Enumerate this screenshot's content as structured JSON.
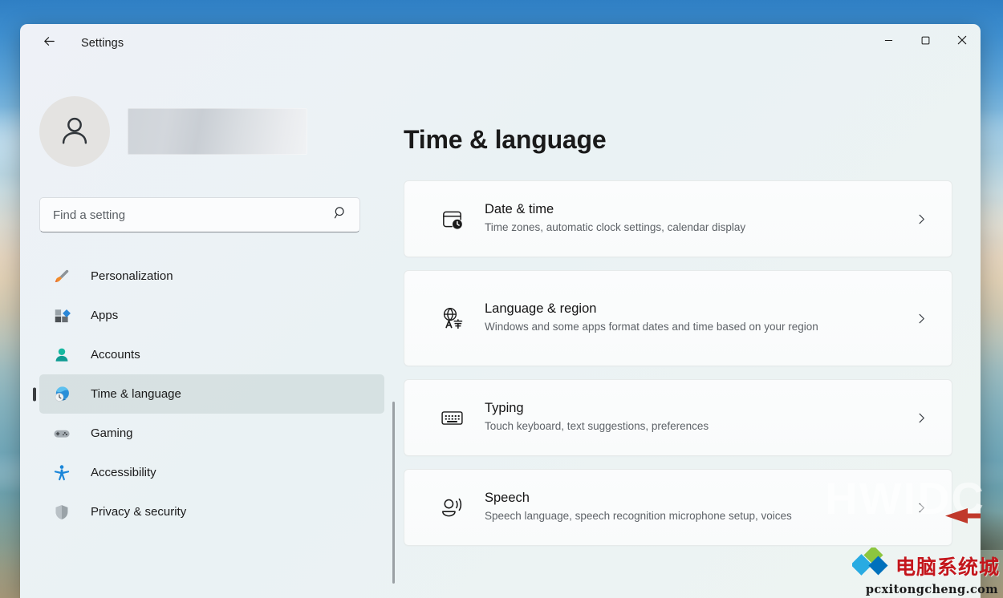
{
  "window": {
    "title": "Settings",
    "back_icon": "back-arrow-icon",
    "controls": {
      "minimize": "minimize-icon",
      "maximize": "maximize-icon",
      "close": "close-icon"
    }
  },
  "sidebar": {
    "avatar_icon": "user-avatar-icon",
    "account_name": "",
    "search": {
      "placeholder": "Find a setting",
      "value": "",
      "icon": "search-icon"
    },
    "items": [
      {
        "label": "Personalization",
        "icon": "paintbrush-icon",
        "active": false
      },
      {
        "label": "Apps",
        "icon": "apps-grid-icon",
        "active": false
      },
      {
        "label": "Accounts",
        "icon": "person-icon",
        "active": false
      },
      {
        "label": "Time & language",
        "icon": "globe-clock-icon",
        "active": true
      },
      {
        "label": "Gaming",
        "icon": "gamepad-icon",
        "active": false
      },
      {
        "label": "Accessibility",
        "icon": "accessibility-icon",
        "active": false
      },
      {
        "label": "Privacy & security",
        "icon": "shield-icon",
        "active": false
      }
    ]
  },
  "main": {
    "page_title": "Time & language",
    "cards": [
      {
        "title": "Date & time",
        "subtitle": "Time zones, automatic clock settings, calendar display",
        "icon": "calendar-clock-icon",
        "chevron": "chevron-right-icon"
      },
      {
        "title": "Language & region",
        "subtitle": "Windows and some apps format dates and time based on your region",
        "icon": "globe-language-icon",
        "chevron": "chevron-right-icon"
      },
      {
        "title": "Typing",
        "subtitle": "Touch keyboard, text suggestions, preferences",
        "icon": "keyboard-icon",
        "chevron": "chevron-right-icon"
      },
      {
        "title": "Speech",
        "subtitle": "Speech language, speech recognition microphone setup, voices",
        "icon": "speech-icon",
        "chevron": "chevron-right-icon"
      }
    ]
  },
  "annotation": {
    "arrow_color": "#c0392b",
    "points_to": "Speech"
  },
  "watermarks": {
    "faint_text": "HWIDC",
    "logo_text": "电脑系统城",
    "logo_url": "pcxitongcheng.com"
  },
  "colors": {
    "accent_selected": "#bccdcd",
    "window_bg": "#eef2f5",
    "card_bg": "#fbfcfd",
    "arrow_red": "#c0392b"
  }
}
